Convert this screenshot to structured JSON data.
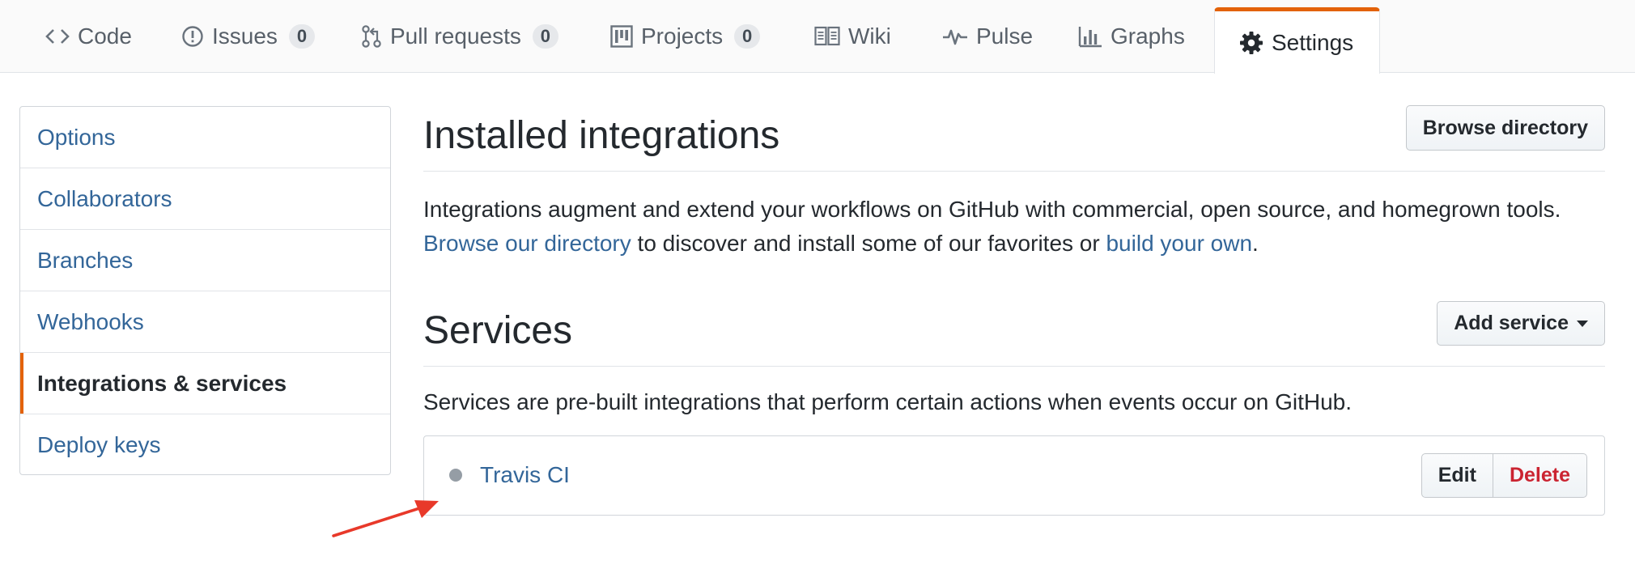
{
  "tabs": [
    {
      "label": "Code",
      "icon": "code-icon",
      "count": null
    },
    {
      "label": "Issues",
      "icon": "issue-icon",
      "count": "0"
    },
    {
      "label": "Pull requests",
      "icon": "pull-request-icon",
      "count": "0"
    },
    {
      "label": "Projects",
      "icon": "project-icon",
      "count": "0"
    },
    {
      "label": "Wiki",
      "icon": "book-icon",
      "count": null
    },
    {
      "label": "Pulse",
      "icon": "pulse-icon",
      "count": null
    },
    {
      "label": "Graphs",
      "icon": "graph-icon",
      "count": null
    },
    {
      "label": "Settings",
      "icon": "gear-icon",
      "count": null,
      "selected": true
    }
  ],
  "sidebar": {
    "items": [
      {
        "label": "Options"
      },
      {
        "label": "Collaborators"
      },
      {
        "label": "Branches"
      },
      {
        "label": "Webhooks"
      },
      {
        "label": "Integrations & services",
        "selected": true
      },
      {
        "label": "Deploy keys"
      }
    ]
  },
  "integrations": {
    "title": "Installed integrations",
    "browse_button": "Browse directory",
    "desc_part1": "Integrations augment and extend your workflows on GitHub with commercial, open source, and homegrown tools. ",
    "desc_link1": "Browse our directory",
    "desc_part2": " to discover and install some of our favorites or ",
    "desc_link2": "build your own",
    "desc_part3": "."
  },
  "services": {
    "title": "Services",
    "add_button": "Add service",
    "description": "Services are pre-built integrations that perform certain actions when events occur on GitHub.",
    "items": [
      {
        "name": "Travis CI",
        "status": "inactive",
        "edit_label": "Edit",
        "delete_label": "Delete"
      }
    ]
  },
  "colors": {
    "accent": "#e36209",
    "link": "#336699",
    "danger": "#cb2431",
    "annotation_arrow": "#e8392a"
  }
}
